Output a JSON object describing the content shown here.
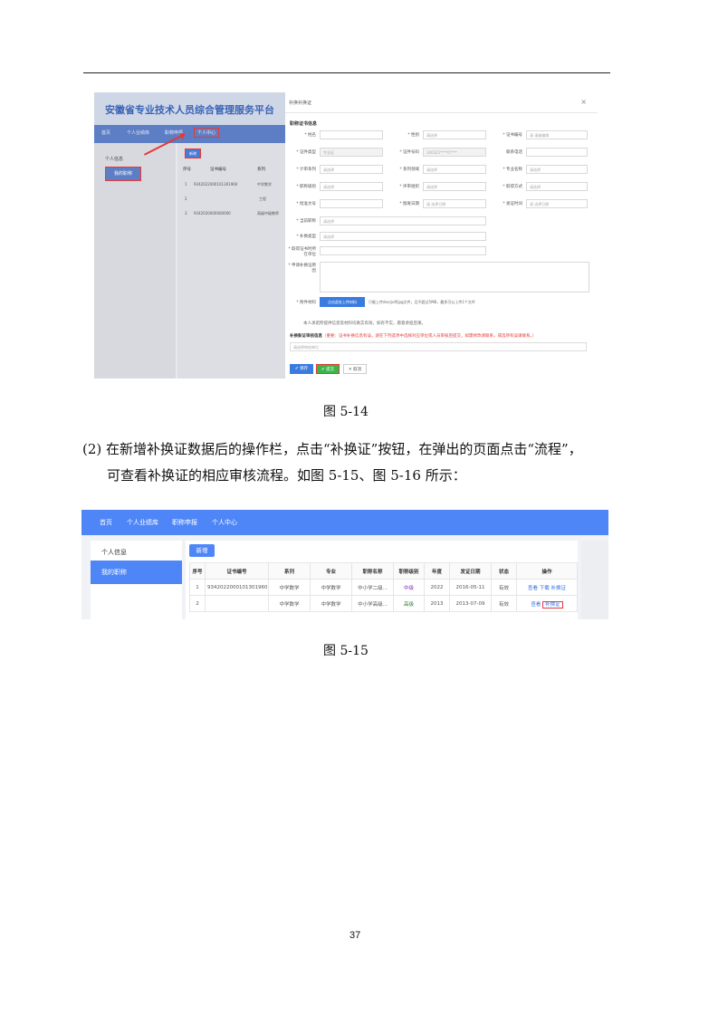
{
  "fig14": {
    "platform_title": "安徽省专业技术人员综合管理服务平台",
    "nav": [
      "首页",
      "个人业绩库",
      "职称申报",
      "个人中心"
    ],
    "side": {
      "item1": "个人信息",
      "item2": "我的职称"
    },
    "new_button": "新增",
    "table_headers": [
      "序号",
      "证书编号",
      "系列"
    ],
    "rows": [
      {
        "no": "1",
        "cert": "9342022000101301960",
        "series": "中学数学"
      },
      {
        "no": "2",
        "cert": "",
        "series": "工程"
      },
      {
        "no": "3",
        "cert": "9342020000000000",
        "series": "高级中级教师"
      }
    ],
    "dialog": {
      "title": "补换补换证",
      "close": "×",
      "section": "职称证书信息",
      "labels": {
        "name": "* 姓名",
        "gender": "* 性别",
        "cert_no": "* 证书编号",
        "id_type": "* 证件类型",
        "id_no": "* 证件号码",
        "phone": "联系电话",
        "series": "* 计审系列",
        "profession": "* 系列领域",
        "major": "* 专业名称",
        "level": "* 职称级别",
        "review_org": "* 评审组织",
        "issue_org": "* 取得方式",
        "approval_doc": "* 批准文号",
        "issue_date": "* 颁发日期",
        "get_time": "* 发证时间",
        "office": "* 当前职称",
        "region": "* 补换类型",
        "reason_sel": "* 取得证书时所在单位",
        "reason": "* 申请补换证原因"
      },
      "placeholders": {
        "gender": "请选择",
        "cert_no": "请 请输编辑",
        "id_type": "专业证",
        "id_no": "340321****0****",
        "series": "请选择",
        "profession": "请选择",
        "major": "请选择",
        "level": "请选择",
        "review_org": "请选择",
        "issue_org": "请选择",
        "approval_doc": "请 选择日期",
        "get_time": "请 选择日期",
        "office": "请选择",
        "region": "请选择"
      },
      "attach_label": "* 附件材料",
      "upload_button": "点击此处上传材料",
      "upload_hint": "只能上传doc/pdf/jpg文件，且不超过5MB，最多可以上传1个文件",
      "confirm_text": "本人承诺所提供信息及材料均真实有效，如有不实，愿意承担后果。",
      "audit_title": "补换新证审核信息",
      "audit_note": "（重要：证书补换信息有误，请在下列选项中选择对应单位或人员审核后提交，如需修改请联系，或选项有误请联系。）",
      "audit_placeholder": "请选择审核单位",
      "btn_save": "✔ 保存",
      "btn_submit": "✔ 提交",
      "btn_cancel": "✕ 取消"
    }
  },
  "caption14": "图 5-14",
  "paragraph": {
    "line1": "(2) 在新增补换证数据后的操作栏，点击“补换证”按钮，在弹出的页面点击“流程”，",
    "line2": "可查看补换证的相应审核流程。如图 5-15、图 5-16 所示："
  },
  "fig15": {
    "nav": [
      "首页",
      "个人业绩库",
      "职称申报",
      "个人中心"
    ],
    "side": {
      "item1": "个人信息",
      "item2": "我的职称"
    },
    "new_button": "新增",
    "headers": [
      "序号",
      "证书编号",
      "系列",
      "专业",
      "职称名称",
      "职称级别",
      "年度",
      "发证日期",
      "状态",
      "操作"
    ],
    "rows": [
      {
        "no": "1",
        "cert": "9342022000101301960",
        "series": "中学数学",
        "major": "中学数学",
        "title": "中小学二级...",
        "level": "中级",
        "year": "2022",
        "date": "2016-05-11",
        "status": "有效",
        "ops": [
          "查看",
          "下载",
          "补换证"
        ]
      },
      {
        "no": "2",
        "cert": "",
        "series": "中学数学",
        "major": "中学数学",
        "title": "中小学高级...",
        "level": "高级",
        "year": "2013",
        "date": "2013-07-09",
        "status": "有效",
        "ops": [
          "查看",
          "补换证"
        ]
      }
    ]
  },
  "caption15": "图 5-15",
  "page_number": "37"
}
